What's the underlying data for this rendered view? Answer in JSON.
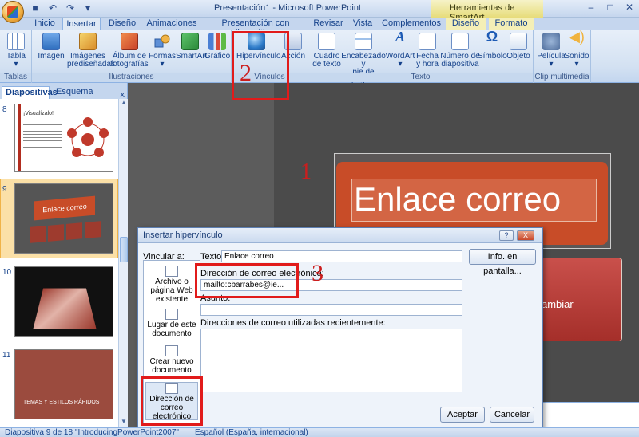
{
  "window": {
    "title": "Presentación1 - Microsoft PowerPoint",
    "context_title": "Herramientas de SmartArt"
  },
  "tabs": [
    "Inicio",
    "Insertar",
    "Diseño",
    "Animaciones",
    "Presentación con diapositivas",
    "Revisar",
    "Vista",
    "Complementos",
    "Diseño",
    "Formato"
  ],
  "ribbon": {
    "groups": {
      "tablas": "Tablas",
      "ilustraciones": "Ilustraciones",
      "vinculos": "Vínculos",
      "texto": "Texto",
      "clip": "Clip multimedia"
    },
    "commands": {
      "tabla": "Tabla",
      "imagen": "Imagen",
      "imagenes_pred_1": "Imágenes",
      "imagenes_pred_2": "prediseñadas",
      "album_1": "Álbum de",
      "album_2": "fotografías",
      "formas": "Formas",
      "smartart": "SmartArt",
      "grafico": "Gráfico",
      "hipervinculo": "Hipervínculo",
      "accion": "Acción",
      "cuadro_1": "Cuadro",
      "cuadro_2": "de texto",
      "encab_1": "Encabezado y",
      "encab_2": "pie de página",
      "wordart": "WordArt",
      "fecha_1": "Fecha",
      "fecha_2": "y hora",
      "numero_1": "Número de",
      "numero_2": "diapositiva",
      "simbolo": "Símbolo",
      "objeto": "Objeto",
      "pelicula": "Película",
      "sonido": "Sonido"
    }
  },
  "left_pane": {
    "tabs": [
      "Diapositivas",
      "Esquema"
    ],
    "close": "x",
    "slides": [
      {
        "num": "8",
        "heading": "¡Visualízalo!"
      },
      {
        "num": "9",
        "heading": "Enlace correo"
      },
      {
        "num": "10",
        "heading": ""
      },
      {
        "num": "11",
        "heading": "TEMAS Y ESTILOS RÁPIDOS"
      }
    ]
  },
  "slide": {
    "title": "Enlace correo",
    "block_text": "ambiar"
  },
  "annotations": {
    "one": "1",
    "two": "2",
    "three": "3"
  },
  "dialog": {
    "title": "Insertar hipervínculo",
    "vincular_a": "Vincular a:",
    "texto_label": "Texto:",
    "texto_value": "Enlace correo",
    "info_btn": "Info. en pantalla...",
    "email_label": "Dirección de correo electrónico:",
    "email_value": "mailto:cbarrabes@ie...",
    "asunto_label": "Asunto:",
    "asunto_value": "",
    "recent_label": "Direcciones de correo utilizadas recientemente:",
    "vinc_items": [
      {
        "line1": "Archivo o",
        "line2": "página Web",
        "line3": "existente"
      },
      {
        "line1": "Lugar de este",
        "line2": "documento",
        "line3": ""
      },
      {
        "line1": "Crear nuevo",
        "line2": "documento",
        "line3": ""
      },
      {
        "line1": "Dirección de",
        "line2": "correo",
        "line3": "electrónico"
      }
    ],
    "ok": "Aceptar",
    "cancel": "Cancelar",
    "help": "?",
    "close": "X"
  },
  "status": {
    "slide": "Diapositiva 9 de 18",
    "theme": "\"IntroducingPowerPoint2007\"",
    "lang": "Español (España, internacional)"
  },
  "colors": {
    "accent_red": "#cc1e1e",
    "slide_orange": "#c84c28",
    "ribbon_blue": "#15428b"
  }
}
